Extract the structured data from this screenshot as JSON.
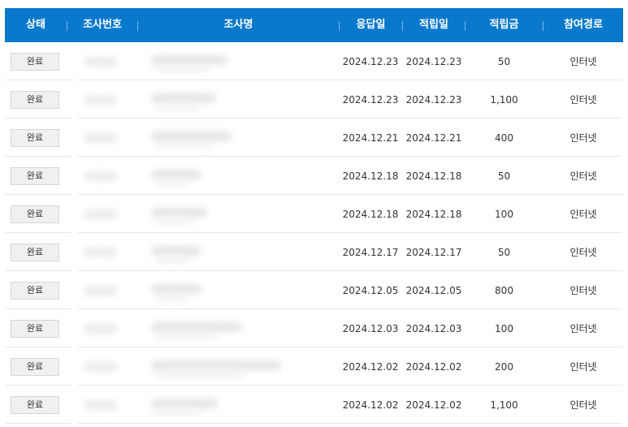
{
  "header": {
    "status": "상태",
    "survey_number": "조사번호",
    "survey_name": "조사명",
    "response_date": "응답일",
    "accrual_date": "적립일",
    "accrual_amount": "적립금",
    "participation_channel": "참여경로"
  },
  "rows": [
    {
      "status": "완료",
      "response_date": "2024.12.23",
      "accrual_date": "2024.12.23",
      "amount": "50",
      "channel": "인터넷"
    },
    {
      "status": "완료",
      "response_date": "2024.12.23",
      "accrual_date": "2024.12.23",
      "amount": "1,100",
      "channel": "인터넷"
    },
    {
      "status": "완료",
      "response_date": "2024.12.21",
      "accrual_date": "2024.12.21",
      "amount": "400",
      "channel": "인터넷"
    },
    {
      "status": "완료",
      "response_date": "2024.12.18",
      "accrual_date": "2024.12.18",
      "amount": "50",
      "channel": "인터넷"
    },
    {
      "status": "완료",
      "response_date": "2024.12.18",
      "accrual_date": "2024.12.18",
      "amount": "100",
      "channel": "인터넷"
    },
    {
      "status": "완료",
      "response_date": "2024.12.17",
      "accrual_date": "2024.12.17",
      "amount": "50",
      "channel": "인터넷"
    },
    {
      "status": "완료",
      "response_date": "2024.12.05",
      "accrual_date": "2024.12.05",
      "amount": "800",
      "channel": "인터넷"
    },
    {
      "status": "완료",
      "response_date": "2024.12.03",
      "accrual_date": "2024.12.03",
      "amount": "100",
      "channel": "인터넷"
    },
    {
      "status": "완료",
      "response_date": "2024.12.02",
      "accrual_date": "2024.12.02",
      "amount": "200",
      "channel": "인터넷"
    },
    {
      "status": "완료",
      "response_date": "2024.12.02",
      "accrual_date": "2024.12.02",
      "amount": "1,100",
      "channel": "인터넷"
    }
  ],
  "colors": {
    "header_bg": "#0a79cc",
    "header_text": "#ffffff",
    "row_divider": "#e7e7e7"
  }
}
